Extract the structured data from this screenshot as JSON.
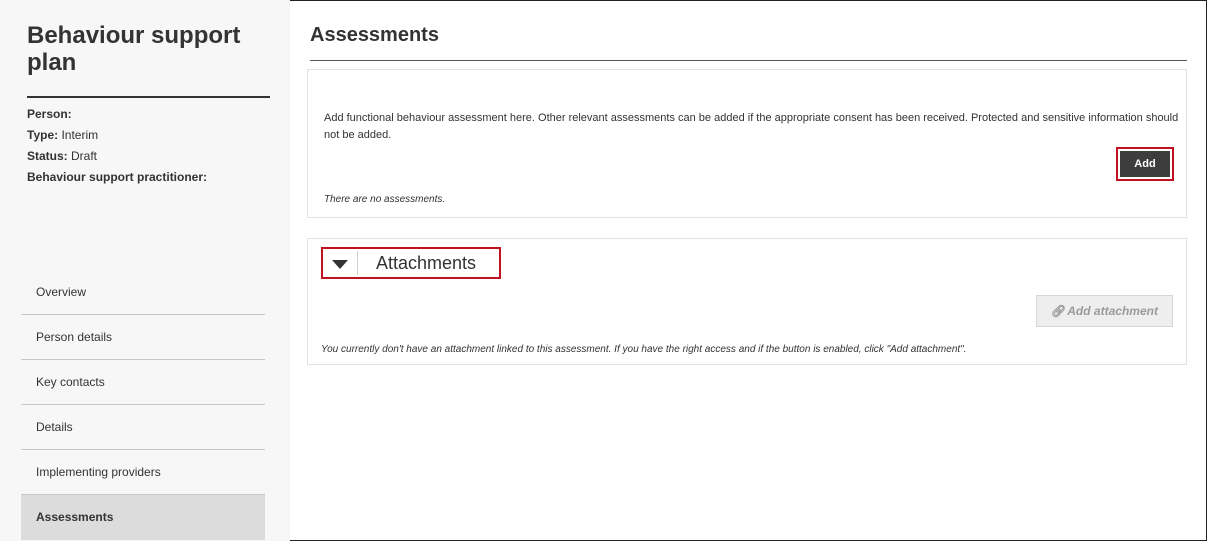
{
  "sidebar": {
    "title": "Behaviour support plan",
    "meta": [
      {
        "key": "Person:",
        "value": ""
      },
      {
        "key": "Type:",
        "value": " Interim"
      },
      {
        "key": "Status:",
        "value": " Draft"
      },
      {
        "key": "Behaviour support practitioner:",
        "value": ""
      }
    ],
    "items": [
      {
        "label": "Overview"
      },
      {
        "label": "Person details"
      },
      {
        "label": "Key contacts"
      },
      {
        "label": "Details"
      },
      {
        "label": "Implementing providers"
      },
      {
        "label": "Assessments",
        "active": true
      }
    ]
  },
  "main": {
    "title": "Assessments",
    "assessment_panel": {
      "description": "Add functional behaviour assessment here. Other relevant assessments can be added if the appropriate consent has been received. Protected and sensitive information should not be added.",
      "add_label": "Add",
      "empty_text": "There are no assessments."
    },
    "attachments": {
      "header": "Attachments",
      "toggle_icon": "caret-down-icon",
      "add_attachment_label": "Add attachment",
      "add_attachment_icon": "paperclip-icon",
      "add_attachment_enabled": false,
      "note": "You currently don't have an attachment linked to this assessment. If you have the right access and if the button is enabled, click \"Add attachment\"."
    }
  },
  "colors": {
    "highlight_outline": "#c0121f",
    "primary_button": "#3d3d3d",
    "sidebar_background": "#f7f7f7",
    "active_nav_background": "#dcdcdc"
  }
}
